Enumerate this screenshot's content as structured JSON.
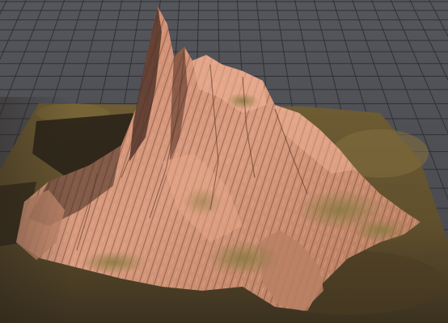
{
  "scene": {
    "description_hidden": "",
    "subject": "terrain-heightmap-render",
    "colors": {
      "background": "#4f5055",
      "grid_line": "#2c2d31",
      "ground_dark": "#3a3020",
      "ground": "#6b5a33",
      "ground_light": "#8a7444",
      "rock_shadow": "#5a3a2e",
      "rock_mid": "#a9705a",
      "rock_light": "#d79a7e",
      "rock_highlight": "#f0b596",
      "moss": "#7a6c3a"
    }
  }
}
